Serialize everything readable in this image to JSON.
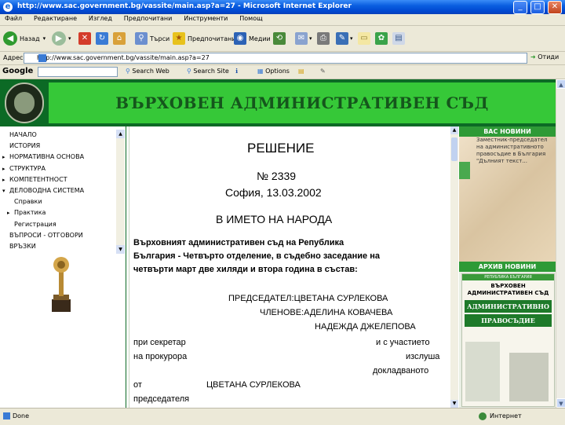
{
  "window": {
    "title": "http://www.sac.government.bg/vassite/main.asp?a=27 - Microsoft Internet Explorer",
    "icon": "ie-icon"
  },
  "menu": [
    "Файл",
    "Редактиране",
    "Изглед",
    "Предпочитани",
    "Инструменти",
    "Помощ"
  ],
  "toolbar": {
    "back": "Назад",
    "search": "Търси",
    "favorites": "Предпочитани",
    "media": "Медии"
  },
  "address": {
    "label": "Адрес",
    "url": "http://www.sac.government.bg/vassite/main.asp?a=27",
    "go": "Отиди"
  },
  "google": {
    "logo": "Google",
    "search_web": "Search Web",
    "search_site": "Search Site",
    "options": "Options"
  },
  "site": {
    "title": "ВЪРХОВЕН АДМИНИСТРАТИВЕН СЪД",
    "nav": [
      {
        "label": "НАЧАЛО",
        "marker": ""
      },
      {
        "label": "ИСТОРИЯ",
        "marker": ""
      },
      {
        "label": "НОРМАТИВНА ОСНОВА",
        "marker": "▸"
      },
      {
        "label": "СТРУКТУРА",
        "marker": "▸"
      },
      {
        "label": "КОМПЕТЕНТНОСТ",
        "marker": "▸"
      },
      {
        "label": "ДЕЛОВОДНА СИСТЕМА",
        "marker": "▾"
      },
      {
        "label": "Справки",
        "marker": "",
        "sub": true
      },
      {
        "label": "Практика",
        "marker": "▸",
        "sub": true
      },
      {
        "label": "Регистрация",
        "marker": "",
        "sub": true
      },
      {
        "label": "ВЪПРОСИ - ОТГОВОРИ",
        "marker": ""
      },
      {
        "label": "ВРЪЗКИ",
        "marker": ""
      }
    ]
  },
  "decision": {
    "heading": "РЕШЕНИЕ",
    "number": "№ 2339",
    "place_date": "София, 13.03.2002",
    "in_name": "В ИМЕТО НА НАРОДА",
    "para1": "Върховният административен съд на Република",
    "para2": "България - Четвърто отделение, в съдебно заседание на",
    "para3": "четвърти март две хиляди и втора година в състав:",
    "chair": "ПРЕДСЕДАТЕЛ:ЦВЕТАНА СУРЛЕКОВА",
    "members": "ЧЛЕНОВЕ:АДЕЛИНА КОВАЧЕВА",
    "member2": "НАДЕЖДА ДЖЕЛЕПОВА",
    "secretary": "при секретар",
    "participation": "и с участието",
    "prosecutor": "на прокурора",
    "heard": "изслуша",
    "reported": "докладваното",
    "from": "от",
    "chair_name": "ЦВЕТАНА СУРЛЕКОВА",
    "chairman": "председателя"
  },
  "right": {
    "news_title": "ВАС НОВИНИ",
    "news_text": "Заместник-председател на административното правосъдие в България \"Дълният текст...",
    "archive_title": "АРХИВ НОВИНИ",
    "cover_top": "РЕПУБЛИКА БЪЛГАРИЯ",
    "cover_title": "ВЪРХОВЕН АДМИНИСТРАТИВЕН СЪД",
    "cover_big1": "АДМИНИСТРАТИВНО",
    "cover_big2": "ПРАВОСЪДИЕ"
  },
  "status": {
    "left": "Done",
    "zone": "Интернет"
  },
  "colors": {
    "banner_dark": "#0c6a25",
    "banner_light": "#36c838",
    "title_text": "#15561c"
  }
}
